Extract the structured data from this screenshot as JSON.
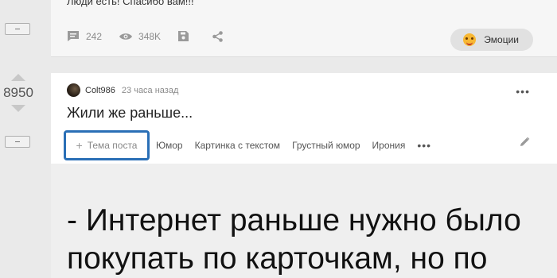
{
  "previous_story": {
    "text_fragment": "Люди есть! Спасибо вам!!!",
    "comments_count": "242",
    "views_count": "348K",
    "emotions_label": "Эмоции"
  },
  "story": {
    "rating": "8950",
    "author": "Colt986",
    "time": "23 часа назад",
    "title": "Жили же раньше...",
    "add_tag_label": "Тема поста",
    "tags": [
      "Юмор",
      "Картинка с текстом",
      "Грустный юмор",
      "Ирония"
    ],
    "text_lines": [
      "- Интернет раньше нужно было",
      "покупать по карточкам, но по"
    ]
  }
}
